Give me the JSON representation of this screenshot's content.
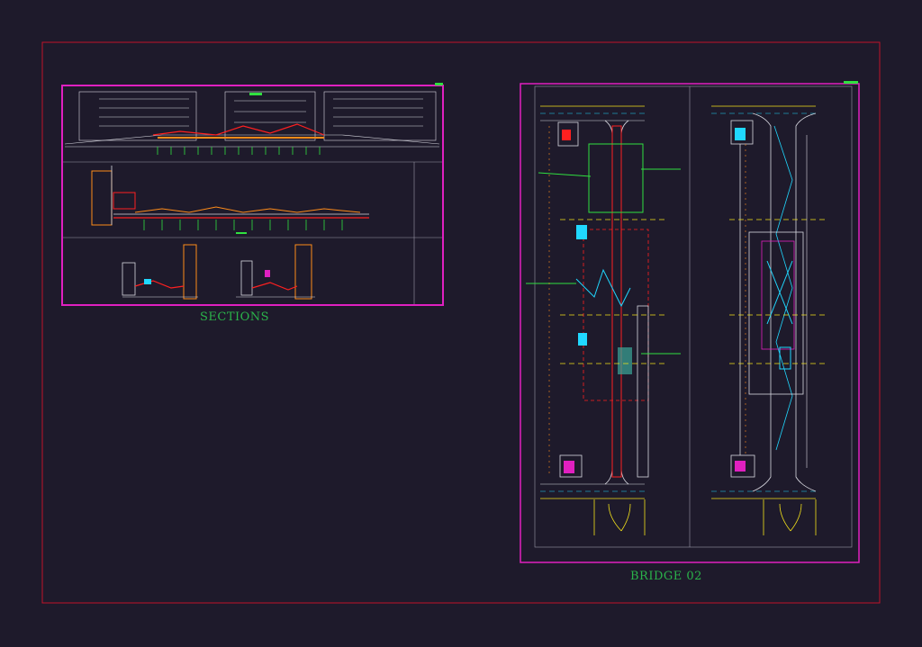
{
  "titles": {
    "sections": "SECTIONS",
    "bridge": "BRIDGE 02"
  },
  "colors": {
    "background": "#1e1a2b",
    "outer_frame": "#c0132a",
    "sheet_frame": "#e020c0",
    "title_text": "#2bb34a",
    "linework": "#d8d8e0",
    "accent_red": "#ff2020",
    "accent_orange": "#ff8c1a",
    "accent_yellow": "#f3e21a",
    "accent_cyan": "#20d8ff",
    "accent_green": "#30e040"
  }
}
